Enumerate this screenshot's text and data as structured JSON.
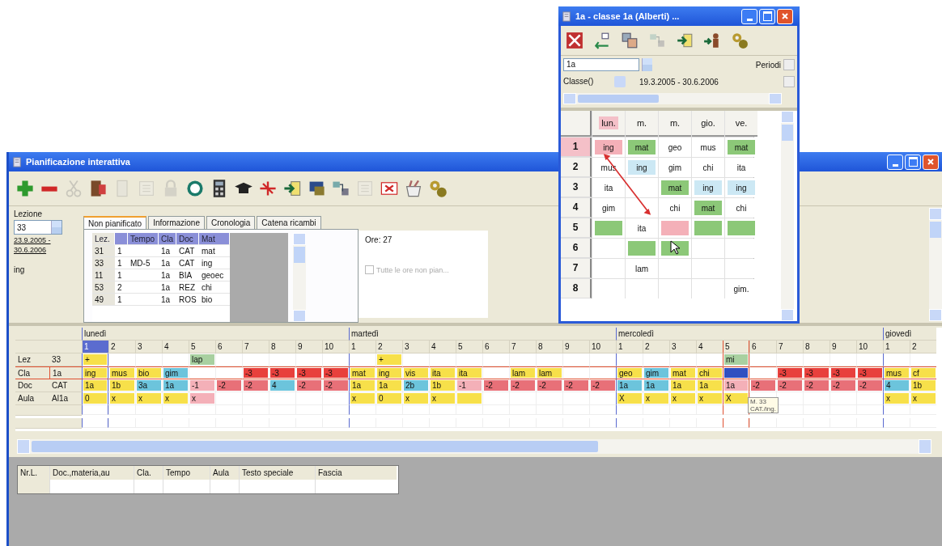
{
  "main_window": {
    "title": "Pianificazione interattiva",
    "toolbar": [
      {
        "kind": "plus",
        "disabled": false
      },
      {
        "kind": "minus",
        "disabled": false
      },
      {
        "kind": "scissors",
        "disabled": true
      },
      {
        "kind": "door",
        "disabled": false
      },
      {
        "kind": "document",
        "disabled": true
      },
      {
        "kind": "list",
        "disabled": true
      },
      {
        "kind": "lock",
        "disabled": true
      },
      {
        "kind": "clock",
        "disabled": false
      },
      {
        "kind": "calculator",
        "disabled": false
      },
      {
        "kind": "cap",
        "disabled": false
      },
      {
        "kind": "cross",
        "disabled": false
      },
      {
        "kind": "arrow",
        "disabled": false
      },
      {
        "kind": "computer",
        "disabled": false
      },
      {
        "kind": "split",
        "disabled": false
      },
      {
        "kind": "list",
        "disabled": true
      },
      {
        "kind": "card",
        "disabled": false
      },
      {
        "kind": "cup",
        "disabled": false
      },
      {
        "kind": "gears",
        "disabled": false
      }
    ],
    "lesson": {
      "label": "Lezione",
      "value": "33",
      "date_from": "23.9.2005 -",
      "date_to": "30.6.2006",
      "subject": "ing"
    },
    "tabs": [
      {
        "label": "Non pianificato",
        "selected": true
      },
      {
        "label": "Informazione",
        "selected": false
      },
      {
        "label": "Cronologia",
        "selected": false
      },
      {
        "label": "Catena ricambi",
        "selected": false
      }
    ],
    "unplanned_table": {
      "columns": [
        "Lez.",
        null,
        "Tempo",
        "Cla",
        "Doc",
        "Mat"
      ],
      "rows": [
        [
          "31",
          "1",
          null,
          "1a",
          "CAT",
          "mat"
        ],
        [
          "33",
          "1",
          "MD-5",
          "1a",
          "CAT",
          "ing"
        ],
        [
          "11",
          "1",
          null,
          "1a",
          "BIA",
          "geoec"
        ],
        [
          "53",
          "2",
          null,
          "1a",
          "REZ",
          "chi"
        ],
        [
          "49",
          "1",
          null,
          "1a",
          "ROS",
          "bio"
        ]
      ]
    },
    "hours": "Ore: 27",
    "all_hours_checkbox": {
      "label": "Tutte le ore non pian...",
      "checked": false,
      "disabled": true
    },
    "grid": {
      "days": [
        {
          "label": "lunedì",
          "periods": [
            {
              "label": "1",
              "selected": true,
              "marked": false
            },
            {
              "label": "2",
              "selected": false,
              "marked": false
            },
            {
              "label": "3",
              "selected": false,
              "marked": false
            },
            {
              "label": "4",
              "selected": false,
              "marked": false
            },
            {
              "label": "5",
              "selected": false,
              "marked": false
            },
            {
              "label": "6",
              "selected": false,
              "marked": false
            },
            {
              "label": "7",
              "selected": false,
              "marked": false
            },
            {
              "label": "8",
              "selected": false,
              "marked": false
            },
            {
              "label": "9",
              "selected": false,
              "marked": false
            },
            {
              "label": "10",
              "selected": false,
              "marked": false
            }
          ]
        },
        {
          "label": "martedì",
          "periods": [
            {
              "label": "1",
              "selected": false,
              "marked": false
            },
            {
              "label": "2",
              "selected": false,
              "marked": false
            },
            {
              "label": "3",
              "selected": false,
              "marked": false
            },
            {
              "label": "4",
              "selected": false,
              "marked": false
            },
            {
              "label": "5",
              "selected": false,
              "marked": false
            },
            {
              "label": "6",
              "selected": false,
              "marked": false
            },
            {
              "label": "7",
              "selected": false,
              "marked": false
            },
            {
              "label": "8",
              "selected": false,
              "marked": false
            },
            {
              "label": "9",
              "selected": false,
              "marked": false
            },
            {
              "label": "10",
              "selected": false,
              "marked": false
            }
          ]
        },
        {
          "label": "mercoledì",
          "periods": [
            {
              "label": "1",
              "selected": false,
              "marked": false
            },
            {
              "label": "2",
              "selected": false,
              "marked": false
            },
            {
              "label": "3",
              "selected": false,
              "marked": false
            },
            {
              "label": "4",
              "selected": false,
              "marked": false
            },
            {
              "label": "5",
              "selected": false,
              "marked": true
            },
            {
              "label": "6",
              "selected": false,
              "marked": false
            },
            {
              "label": "7",
              "selected": false,
              "marked": false
            },
            {
              "label": "8",
              "selected": false,
              "marked": false
            },
            {
              "label": "9",
              "selected": false,
              "marked": false
            },
            {
              "label": "10",
              "selected": false,
              "marked": false
            }
          ]
        },
        {
          "label": "giovedì",
          "periods": [
            {
              "label": "1",
              "selected": false,
              "marked": false
            },
            {
              "label": "2",
              "selected": false,
              "marked": false
            }
          ]
        }
      ],
      "rows": [
        {
          "label": "Lez",
          "value": "33",
          "outlined": false,
          "cells": [
            {
              "text": "+",
              "color": "#f7e04a"
            },
            null,
            null,
            null,
            {
              "text": "lap",
              "color": "#a8d0a0"
            },
            null,
            null,
            null,
            null,
            null,
            null,
            {
              "text": "+",
              "color": "#f7e04a"
            },
            null,
            null,
            null,
            null,
            null,
            null,
            null,
            null,
            null,
            null,
            null,
            null,
            {
              "text": "mi",
              "color": "#a8d0a0"
            },
            null,
            null,
            null,
            null,
            null,
            null,
            null
          ]
        },
        {
          "label": "Cla",
          "value": "1a",
          "outlined": true,
          "cells": [
            {
              "text": "ing",
              "color": "#f7e04a"
            },
            {
              "text": "mus",
              "color": "#f7e04a"
            },
            {
              "text": "bio",
              "color": "#f7e04a"
            },
            {
              "text": "gim",
              "color": "#6cc4dc"
            },
            null,
            null,
            {
              "text": "-3",
              "color": "#e8403c"
            },
            {
              "text": "-3",
              "color": "#e8403c"
            },
            {
              "text": "-3",
              "color": "#e8403c"
            },
            {
              "text": "-3",
              "color": "#e8403c"
            },
            {
              "text": "mat",
              "color": "#f7e04a"
            },
            {
              "text": "ing",
              "color": "#f7e04a"
            },
            {
              "text": "vis",
              "color": "#f7e04a"
            },
            {
              "text": "ita",
              "color": "#f7e04a"
            },
            {
              "text": "ita",
              "color": "#f7e04a"
            },
            null,
            {
              "text": "lam",
              "color": "#f7e04a"
            },
            {
              "text": "lam",
              "color": "#f7e04a"
            },
            null,
            null,
            {
              "text": "geo",
              "color": "#f7e04a"
            },
            {
              "text": "gim",
              "color": "#6cc4dc"
            },
            {
              "text": "mat",
              "color": "#f7e04a"
            },
            {
              "text": "chi",
              "color": "#f7e04a"
            },
            {
              "color": "#3050c0"
            },
            null,
            {
              "text": "-3",
              "color": "#e8403c"
            },
            {
              "text": "-3",
              "color": "#e8403c"
            },
            {
              "text": "-3",
              "color": "#e8403c"
            },
            {
              "text": "-3",
              "color": "#e8403c"
            },
            {
              "text": "mus",
              "color": "#f7e04a"
            },
            {
              "text": "cf",
              "color": "#f7e04a"
            }
          ]
        },
        {
          "label": "Doc",
          "value": "CAT",
          "outlined": false,
          "cells": [
            {
              "text": "1a",
              "color": "#f7e04a"
            },
            {
              "text": "1b",
              "color": "#f7e04a"
            },
            {
              "text": "3a",
              "color": "#6cc4dc"
            },
            {
              "text": "1a",
              "color": "#6cc4dc"
            },
            {
              "text": "-1",
              "color": "#f4b0b8"
            },
            {
              "text": "-2",
              "color": "#e87078"
            },
            {
              "text": "-2",
              "color": "#e87078"
            },
            {
              "text": "4",
              "color": "#6cc4dc"
            },
            {
              "text": "-2",
              "color": "#e87078"
            },
            {
              "text": "-2",
              "color": "#e87078"
            },
            {
              "text": "1a",
              "color": "#f7e04a"
            },
            {
              "text": "1a",
              "color": "#f7e04a"
            },
            {
              "text": "2b",
              "color": "#6cc4dc"
            },
            {
              "text": "1b",
              "color": "#f7e04a"
            },
            {
              "text": "-1",
              "color": "#f4b0b8"
            },
            {
              "text": "-2",
              "color": "#e87078"
            },
            {
              "text": "-2",
              "color": "#e87078"
            },
            {
              "text": "-2",
              "color": "#e87078"
            },
            {
              "text": "-2",
              "color": "#e87078"
            },
            {
              "text": "-2",
              "color": "#e87078"
            },
            {
              "text": "1a",
              "color": "#6cc4dc"
            },
            {
              "text": "1a",
              "color": "#6cc4dc"
            },
            {
              "text": "1a",
              "color": "#f7e04a"
            },
            {
              "text": "1a",
              "color": "#f7e04a"
            },
            {
              "text": "1a",
              "color": "#f4b0b8"
            },
            {
              "text": "-2",
              "color": "#e87078"
            },
            {
              "text": "-2",
              "color": "#e87078"
            },
            {
              "text": "-2",
              "color": "#e87078"
            },
            {
              "text": "-2",
              "color": "#e87078"
            },
            {
              "text": "-2",
              "color": "#e87078"
            },
            {
              "text": "4",
              "color": "#6cc4dc"
            },
            {
              "text": "1b",
              "color": "#f7e04a"
            }
          ]
        },
        {
          "label": "Aula",
          "value": "Al1a",
          "outlined": false,
          "cells": [
            {
              "text": "0",
              "color": "#f7e04a"
            },
            {
              "text": "x",
              "color": "#f7e04a"
            },
            {
              "text": "x",
              "color": "#f7e04a"
            },
            {
              "text": "x",
              "color": "#f7e04a"
            },
            {
              "text": "x",
              "color": "#f4b0b8"
            },
            null,
            null,
            null,
            null,
            null,
            {
              "text": "x",
              "color": "#f7e04a"
            },
            {
              "text": "0",
              "color": "#f7e04a"
            },
            {
              "text": "x",
              "color": "#f7e04a"
            },
            {
              "text": "x",
              "color": "#f7e04a"
            },
            {
              "color": "#f7e04a"
            },
            null,
            null,
            null,
            null,
            null,
            {
              "text": "X",
              "color": "#f7e04a"
            },
            {
              "text": "x",
              "color": "#f7e04a"
            },
            {
              "text": "x",
              "color": "#f7e04a"
            },
            {
              "text": "x",
              "color": "#f7e04a"
            },
            {
              "text": "X",
              "color": "#f7e04a",
              "tooltip": [
                "M. 33",
                "CAT./ing."
              ]
            },
            null,
            null,
            null,
            null,
            null,
            {
              "text": "x",
              "color": "#f7e04a"
            },
            {
              "text": "x",
              "color": "#f7e04a"
            }
          ]
        }
      ]
    },
    "bottom_table": {
      "columns": [
        "Nr.L.",
        "Doc.,materia,au",
        "Cla.",
        "Tempo",
        "Aula",
        "Testo speciale",
        "Fascia"
      ]
    }
  },
  "class_window": {
    "title": "1a - classe 1a (Alberti) ...",
    "toolbar": [
      {
        "kind": "expand",
        "disabled": false
      },
      {
        "kind": "swap",
        "disabled": false
      },
      {
        "kind": "copy",
        "disabled": false
      },
      {
        "kind": "split",
        "disabled": true
      },
      {
        "kind": "arrow",
        "disabled": false
      },
      {
        "kind": "person",
        "disabled": false
      },
      {
        "kind": "gears",
        "disabled": false
      }
    ],
    "element": "1a",
    "element_type": "Classe()",
    "period_label": "Periodi",
    "date_range": "19.3.2005 - 30.6.2006",
    "days": [
      {
        "label": "lun.",
        "selected": true
      },
      {
        "label": "m.",
        "selected": false
      },
      {
        "label": "m.",
        "selected": false
      },
      {
        "label": "gio.",
        "selected": false
      },
      {
        "label": "ve.",
        "selected": false
      }
    ],
    "hours": [
      {
        "label": "1",
        "selected": true,
        "cells": [
          {
            "text": "ing",
            "color": "#f4b0b8"
          },
          {
            "text": "mat",
            "color": "#8cc878"
          },
          {
            "text": "geo"
          },
          {
            "text": "mus"
          },
          {
            "text": "mat",
            "color": "#8cc878"
          }
        ]
      },
      {
        "label": "2",
        "selected": false,
        "cells": [
          {
            "text": "mus"
          },
          {
            "text": "ing",
            "color": "#cce8f4"
          },
          {
            "text": "gim"
          },
          {
            "text": "chi"
          },
          {
            "text": "ita"
          }
        ]
      },
      {
        "label": "3",
        "selected": false,
        "cells": [
          {
            "text": "ita"
          },
          null,
          {
            "text": "mat",
            "color": "#8cc878"
          },
          {
            "text": "ing",
            "color": "#cce8f4"
          },
          {
            "text": "ing",
            "color": "#cce8f4"
          }
        ]
      },
      {
        "label": "4",
        "selected": false,
        "cells": [
          {
            "text": "gim"
          },
          null,
          {
            "text": "chi"
          },
          {
            "text": "mat",
            "color": "#8cc878"
          },
          {
            "text": "chi"
          }
        ]
      },
      {
        "label": "5",
        "selected": false,
        "cells": [
          {
            "color": "#8cc878"
          },
          {
            "text": "ita"
          },
          {
            "color": "#f4b0b8"
          },
          {
            "color": "#8cc878"
          },
          {
            "color": "#8cc878"
          }
        ]
      },
      {
        "label": "6",
        "selected": false,
        "cells": [
          null,
          {
            "color": "#8cc878"
          },
          {
            "color": "#8cc878"
          },
          null,
          null
        ]
      },
      {
        "label": "7",
        "selected": false,
        "cells": [
          null,
          {
            "text": "lam"
          },
          null,
          null,
          null
        ]
      },
      {
        "label": "8",
        "selected": false,
        "cells": [
          null,
          null,
          null,
          null,
          {
            "text": "gim."
          }
        ]
      }
    ]
  }
}
